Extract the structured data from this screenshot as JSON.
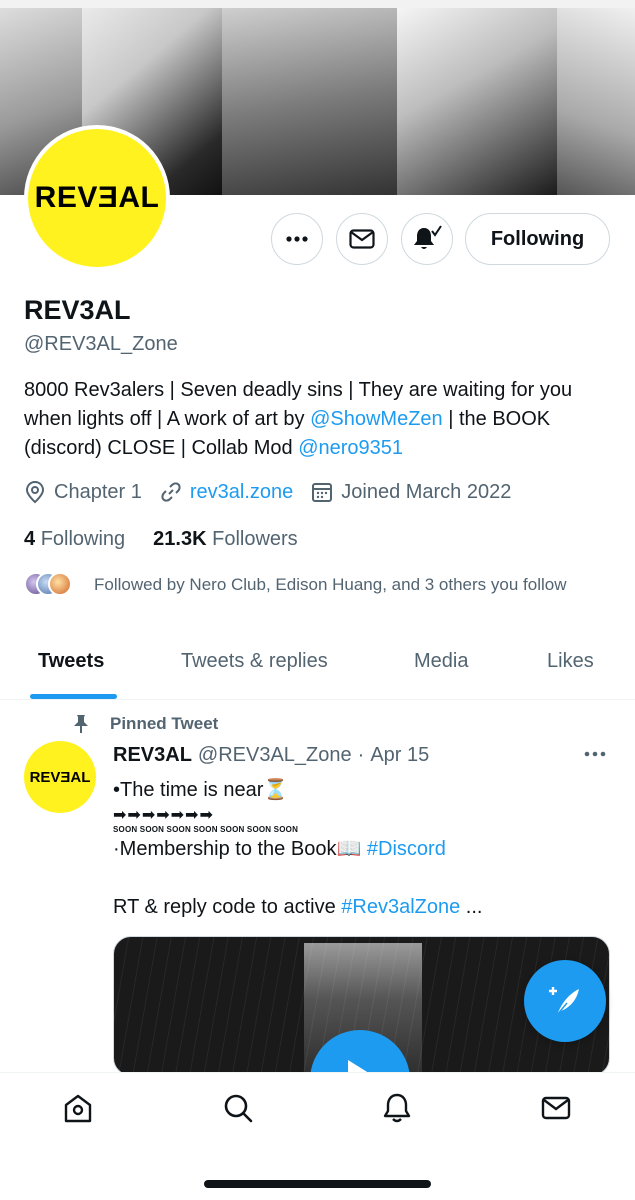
{
  "profile": {
    "name": "REV3AL",
    "handle": "@REV3AL_Zone",
    "avatar_text": "REVƎAL",
    "bio_parts": {
      "p1": "8000 Rev3alers | Seven deadly sins | They are waiting for you when lights off | A work of art by ",
      "link1": "@ShowMeZen",
      "p2": " | the BOOK (discord) CLOSE  | Collab Mod ",
      "link2": "@nero9351"
    },
    "location": "Chapter 1",
    "website": "rev3al.zone",
    "joined": "Joined March 2022",
    "following_count": "4",
    "following_label": "Following",
    "followers_count": "21.3K",
    "followers_label": "Followers",
    "followed_by": "Followed by Nero Club, Edison Huang, and 3 others you follow"
  },
  "actions": {
    "more_icon": "more-icon",
    "message_icon": "mail-icon",
    "notifications_icon": "bell-check-icon",
    "following_label": "Following"
  },
  "tabs": [
    {
      "label": "Tweets",
      "active": true
    },
    {
      "label": "Tweets & replies",
      "active": false
    },
    {
      "label": "Media",
      "active": false
    },
    {
      "label": "Likes",
      "active": false
    }
  ],
  "tweet": {
    "pinned_label": "Pinned Tweet",
    "author_name": "REV3AL",
    "author_handle": "@REV3AL_Zone",
    "separator": "·",
    "date": "Apr 15",
    "avatar_text": "REVƎAL",
    "line1": "•The time is near",
    "hourglass": "⏳",
    "arrows": "➡➡➡➡➡➡➡",
    "soon": "SOON SOON SOON SOON SOON SOON SOON",
    "line3_text": "·Membership to the Book",
    "book_emoji": "📖",
    "line3_tag": " #Discord",
    "line4_text": "RT & reply code to active ",
    "line4_tag": "#Rev3alZone",
    "line4_end": " ..."
  },
  "colors": {
    "accent": "#1d9bf0",
    "avatar_yellow": "#fff21f",
    "secondary_text": "#536471",
    "primary_text": "#0f1419"
  },
  "bottom_nav": [
    "home-icon",
    "search-icon",
    "notifications-icon",
    "messages-icon"
  ]
}
